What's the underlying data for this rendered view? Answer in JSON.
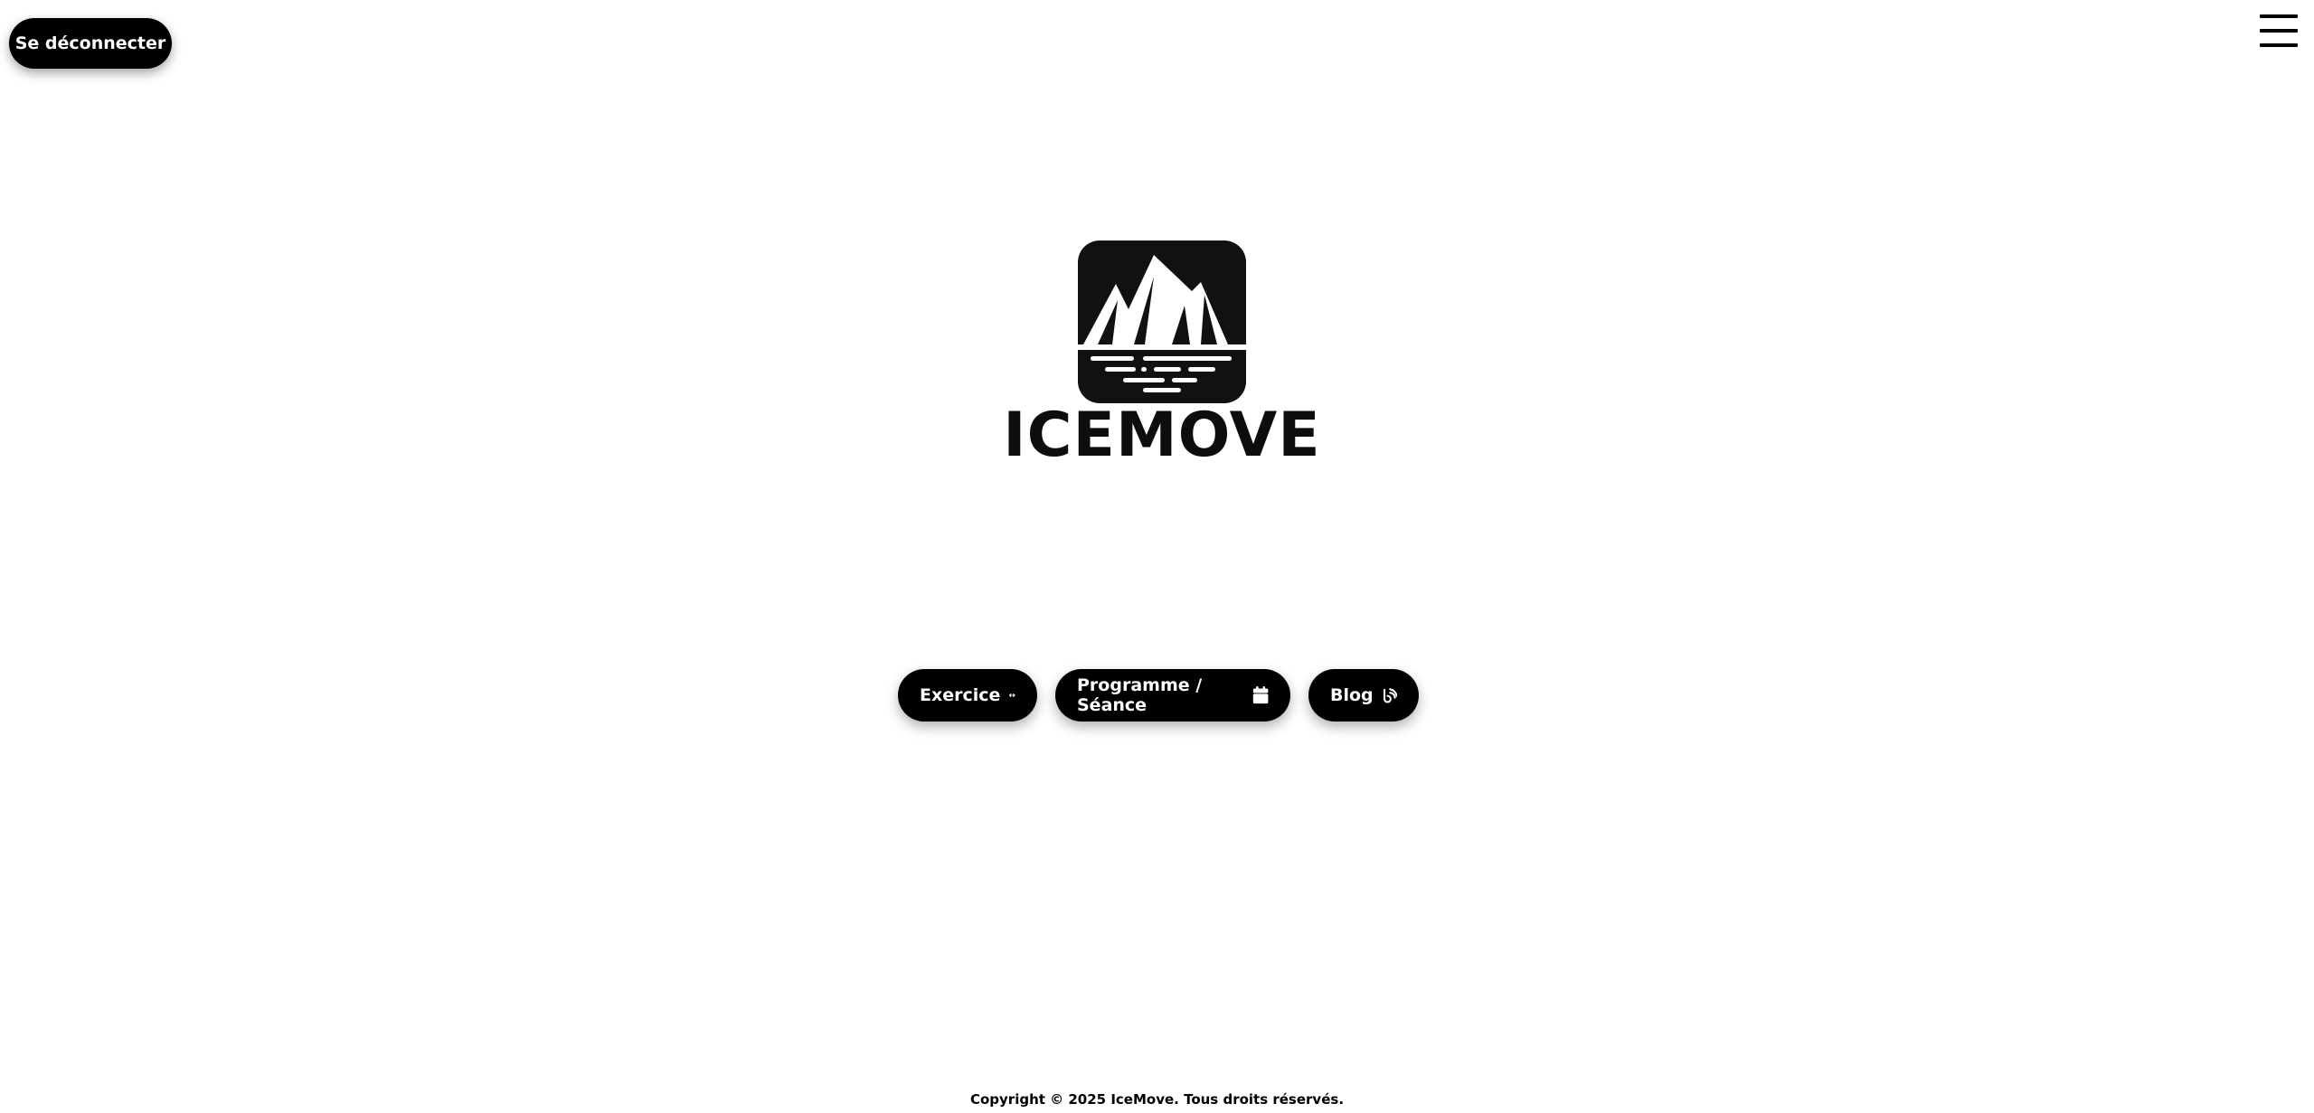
{
  "header": {
    "logout_label": "Se déconnecter"
  },
  "brand": {
    "name": "ICEMOVE"
  },
  "nav": {
    "exercise_label": "Exercice",
    "program_label": "Programme / Séance",
    "blog_label": "Blog"
  },
  "icons": {
    "exercise": "dumbbell-icon",
    "program": "calendar-icon",
    "blog": "blog-icon",
    "menu": "hamburger-menu-icon",
    "logo": "mountain-logo-icon"
  },
  "footer": {
    "copyright": "Copyright © 2025 IceMove. Tous droits réservés."
  },
  "colors": {
    "background": "#ffffff",
    "button": "#000000",
    "button_text": "#ffffff",
    "logo": "#111111"
  }
}
